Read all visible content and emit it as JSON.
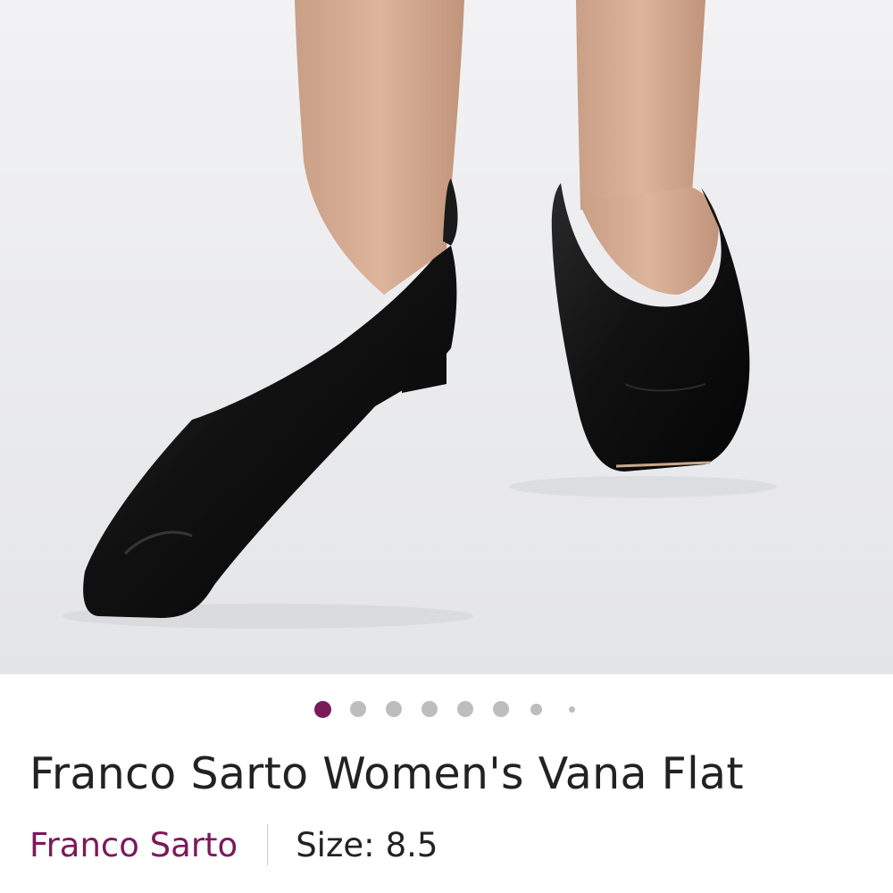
{
  "product": {
    "title": "Franco Sarto Women's Vana Flat",
    "brand": "Franco Sarto",
    "size_label": "Size:",
    "size_value": "8.5"
  },
  "carousel": {
    "total_images": 8,
    "active_index": 0
  },
  "colors": {
    "accent": "#7a1a5a",
    "text": "#222222",
    "dot_inactive": "#bdbdbd",
    "photo_background": "#ecedef"
  }
}
